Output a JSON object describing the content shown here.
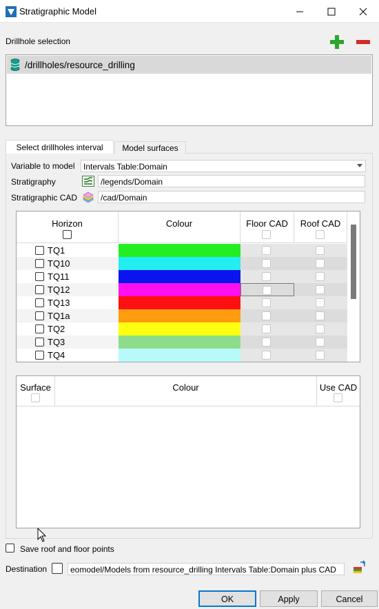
{
  "window": {
    "title": "Stratigraphic Model"
  },
  "drillhole": {
    "section_label": "Drillhole selection",
    "items": [
      "/drillholes/resource_drilling"
    ]
  },
  "tabs": [
    {
      "label": "Select drillholes interval",
      "active": true
    },
    {
      "label": "Model surfaces",
      "active": false
    }
  ],
  "form": {
    "variable_label": "Variable to model",
    "variable_value": "Intervals Table:Domain",
    "stratigraphy_label": "Stratigraphy",
    "stratigraphy_value": "/legends/Domain",
    "strat_cad_label": "Stratigraphic CAD",
    "strat_cad_value": "/cad/Domain"
  },
  "horizon_table": {
    "headers": [
      "Horizon",
      "Colour",
      "Floor CAD",
      "Roof CAD"
    ],
    "rows": [
      {
        "name": "TQ1",
        "colour": "#22ee22"
      },
      {
        "name": "TQ10",
        "colour": "#22eef2"
      },
      {
        "name": "TQ11",
        "colour": "#0a14ee"
      },
      {
        "name": "TQ12",
        "colour": "#ff10ee"
      },
      {
        "name": "TQ13",
        "colour": "#ff1010"
      },
      {
        "name": "TQ1a",
        "colour": "#ff9c10"
      },
      {
        "name": "TQ2",
        "colour": "#ffff10"
      },
      {
        "name": "TQ3",
        "colour": "#8edc8a"
      },
      {
        "name": "TQ4",
        "colour": "#b8fafa"
      }
    ]
  },
  "surface_table": {
    "headers": [
      "Surface",
      "Colour",
      "Use CAD"
    ]
  },
  "save_points_label": "Save roof and floor points",
  "destination": {
    "label": "Destination",
    "value": "eomodel/Models from resource_drilling Intervals Table:Domain plus CAD"
  },
  "buttons": {
    "ok": "OK",
    "apply": "Apply",
    "cancel": "Cancel"
  },
  "colors": {
    "accent": "#0078d7",
    "add": "#2ea52e",
    "remove": "#d22b2b"
  }
}
